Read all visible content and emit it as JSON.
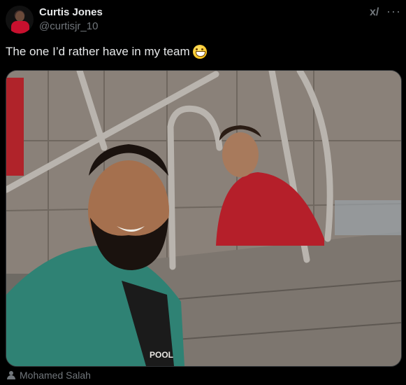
{
  "author": {
    "display_name": "Curtis Jones",
    "handle": "@curtisjr_10"
  },
  "toolbar": {
    "grok_icon": "grok-icon",
    "grok_glyph": "x/",
    "more_glyph": "···"
  },
  "tweet": {
    "text": "The one I’d rather have in my team",
    "emoji": "grinning-face-emoji"
  },
  "media": {
    "tagged_person": "Mohamed Salah",
    "shirt_text": "POOL"
  }
}
